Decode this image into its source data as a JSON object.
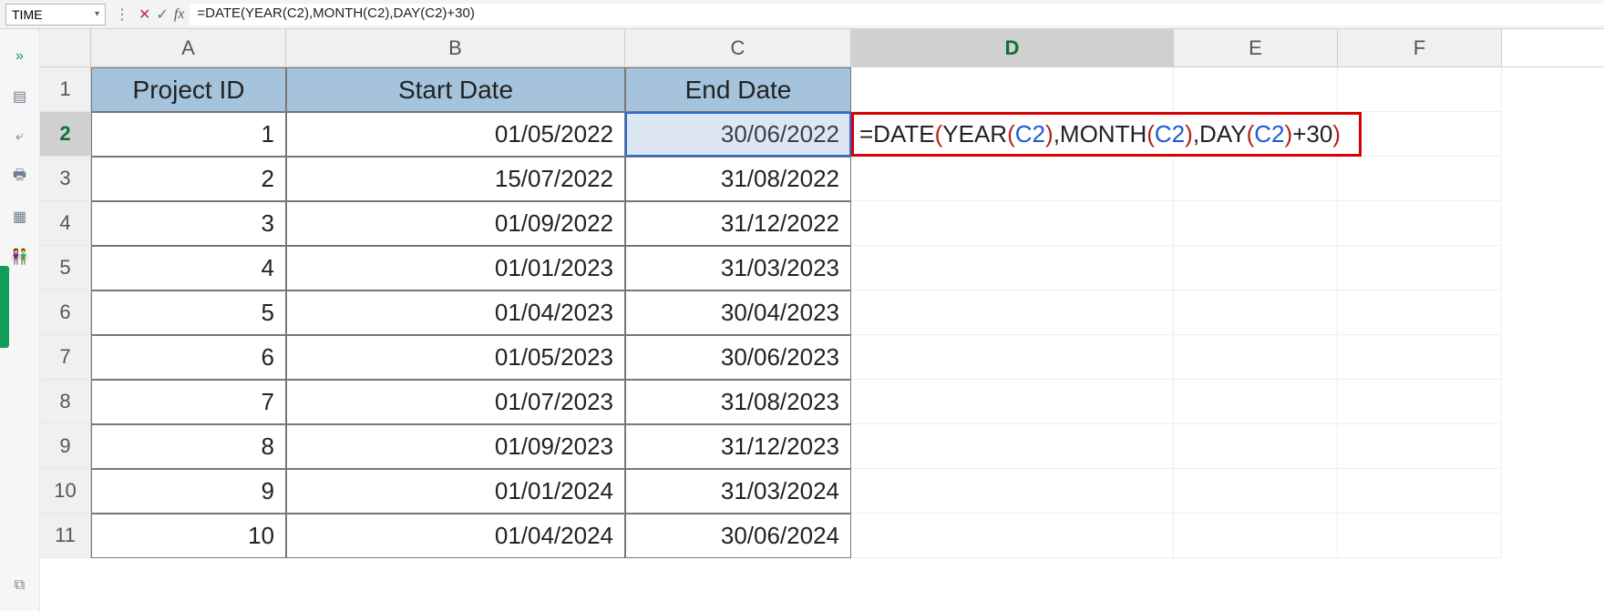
{
  "formula_bar": {
    "name_box_value": "TIME",
    "formula_text": "=DATE(YEAR(C2),MONTH(C2),DAY(C2)+30)"
  },
  "columns": [
    "A",
    "B",
    "C",
    "D",
    "E",
    "F"
  ],
  "active_column": "D",
  "active_row": "2",
  "headers": {
    "A": "Project ID",
    "B": "Start Date",
    "C": "End Date"
  },
  "rows": [
    {
      "num": "1",
      "A": "",
      "B": "",
      "C": ""
    },
    {
      "num": "2",
      "A": "1",
      "B": "01/05/2022",
      "C": "30/06/2022"
    },
    {
      "num": "3",
      "A": "2",
      "B": "15/07/2022",
      "C": "31/08/2022"
    },
    {
      "num": "4",
      "A": "3",
      "B": "01/09/2022",
      "C": "31/12/2022"
    },
    {
      "num": "5",
      "A": "4",
      "B": "01/01/2023",
      "C": "31/03/2023"
    },
    {
      "num": "6",
      "A": "5",
      "B": "01/04/2023",
      "C": "30/04/2023"
    },
    {
      "num": "7",
      "A": "6",
      "B": "01/05/2023",
      "C": "30/06/2023"
    },
    {
      "num": "8",
      "A": "7",
      "B": "01/07/2023",
      "C": "31/08/2023"
    },
    {
      "num": "9",
      "A": "8",
      "B": "01/09/2023",
      "C": "31/12/2023"
    },
    {
      "num": "10",
      "A": "9",
      "B": "01/01/2024",
      "C": "31/03/2024"
    },
    {
      "num": "11",
      "A": "10",
      "B": "01/04/2024",
      "C": "30/06/2024"
    }
  ],
  "cell_d2_formula_parts": {
    "p1": "=DATE",
    "p2": "(",
    "p3": "YEAR",
    "p4": "(",
    "ref1": "C2",
    "p5": ")",
    "p6": ",MONTH",
    "p7": "(",
    "ref2": "C2",
    "p8": ")",
    "p9": ",DAY",
    "p10": "(",
    "ref3": "C2",
    "p11": ")",
    "p12": "+30",
    "p13": ")"
  }
}
